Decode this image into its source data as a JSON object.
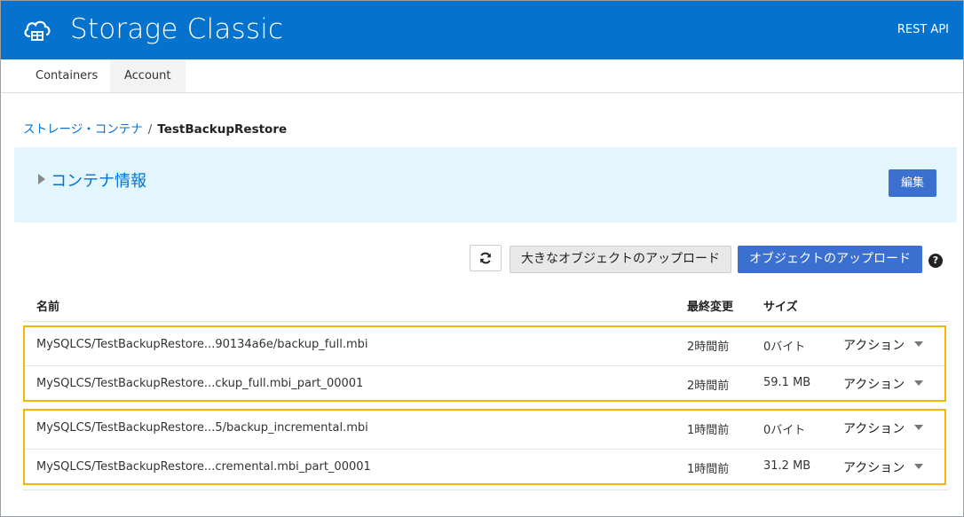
{
  "header": {
    "title": "Storage Classic",
    "rest_api": "REST API"
  },
  "tabs": [
    {
      "label": "Containers"
    },
    {
      "label": "Account"
    }
  ],
  "breadcrumb": {
    "parent": "ストレージ・コンテナ",
    "separator": "/",
    "current": "TestBackupRestore"
  },
  "container_info": {
    "label": "コンテナ情報",
    "edit_label": "編集"
  },
  "toolbar": {
    "upload_large_label": "大きなオブジェクトのアップロード",
    "upload_label": "オブジェクトのアップロード",
    "help_label": "?"
  },
  "table": {
    "columns": {
      "name": "名前",
      "modified": "最終変更",
      "size": "サイズ"
    },
    "rows": [
      {
        "name": "MySQLCS/TestBackupRestore...90134a6e/backup_full.mbi",
        "modified": "2時間前",
        "size": "0バイト",
        "action": "アクション"
      },
      {
        "name": "MySQLCS/TestBackupRestore...ckup_full.mbi_part_00001",
        "modified": "2時間前",
        "size": "59.1 MB",
        "action": "アクション"
      },
      {
        "name": "MySQLCS/TestBackupRestore...5/backup_incremental.mbi",
        "modified": "1時間前",
        "size": "0バイト",
        "action": "アクション"
      },
      {
        "name": "MySQLCS/TestBackupRestore...cremental.mbi_part_00001",
        "modified": "1時間前",
        "size": "31.2 MB",
        "action": "アクション"
      }
    ]
  },
  "colors": {
    "header_bg": "#0572ce",
    "primary_button": "#3b6fd0",
    "info_bg": "#e4f6fd",
    "highlight": "#f0b800"
  }
}
